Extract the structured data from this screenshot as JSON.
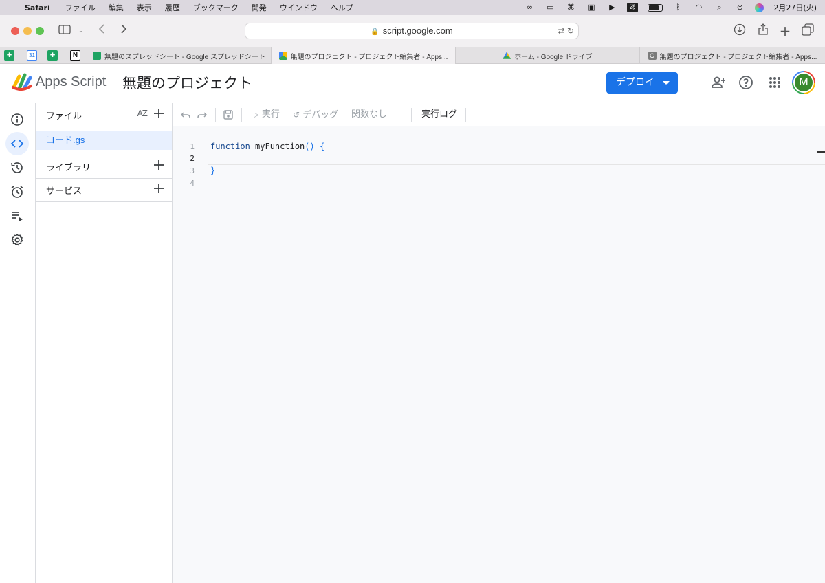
{
  "menubar": {
    "app": "Safari",
    "items": [
      "ファイル",
      "編集",
      "表示",
      "履歴",
      "ブックマーク",
      "開発",
      "ウインドウ",
      "ヘルプ"
    ],
    "ime": "あ",
    "datetime": "2月27日(火)"
  },
  "browser": {
    "url": "script.google.com",
    "tabs": [
      {
        "title": "無題のスプレッドシート - Google スプレッドシート"
      },
      {
        "title": "無題のプロジェクト - プロジェクト編集者 - Apps..."
      },
      {
        "title": "ホーム - Google ドライブ"
      },
      {
        "title": "無題のプロジェクト - プロジェクト編集者 - Apps..."
      }
    ],
    "pinned_cal_label": "31",
    "pinned_notion_label": "N",
    "last_tab_favicon_letter": "G"
  },
  "header": {
    "brand": "Apps Script",
    "project_title": "無題のプロジェクト",
    "deploy_label": "デプロイ",
    "avatar_letter": "M"
  },
  "files": {
    "section_label": "ファイル",
    "sort_label": "AZ",
    "items": [
      {
        "name": "コード.gs"
      }
    ],
    "libraries_label": "ライブラリ",
    "services_label": "サービス"
  },
  "editor_toolbar": {
    "run_label": "実行",
    "debug_label": "デバッグ",
    "function_select": "関数なし",
    "exec_log_label": "実行ログ"
  },
  "editor": {
    "line_numbers": [
      "1",
      "2",
      "3",
      "4"
    ],
    "current_line": "2",
    "keyword": "function",
    "func_name": " myFunction",
    "parens": "()",
    "brace_open": " {",
    "brace_close": "}"
  },
  "colors": {
    "accent": "#1a73e8",
    "selected_bg": "#e8f0fe",
    "editor_bg": "#f8f9fb",
    "avatar_bg": "#3a8a2e"
  }
}
